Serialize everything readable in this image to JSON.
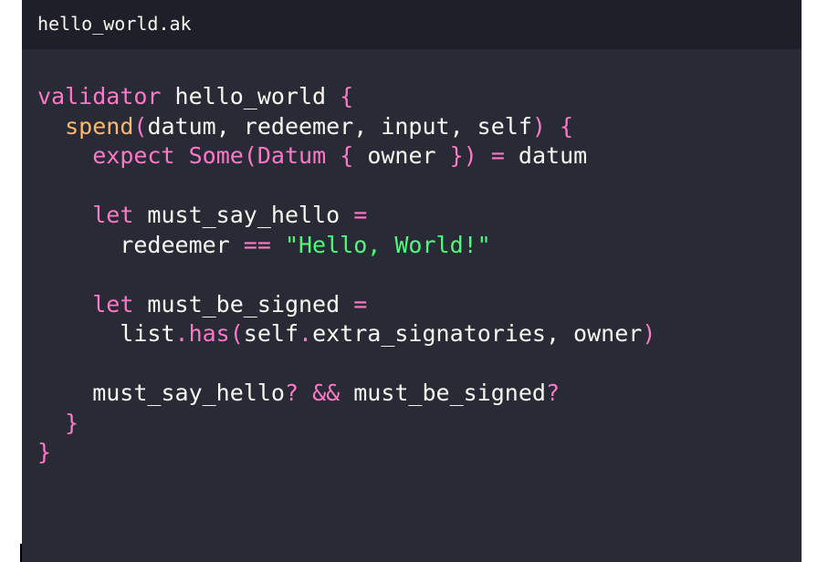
{
  "tab": {
    "filename": "hello_world.ak"
  },
  "theme": {
    "background": "#282a36",
    "tabbar_background": "#1e1f29",
    "text": "#f8f8f2",
    "keyword": "#ff79c6",
    "function": "#ffb86c",
    "string": "#50fa7b"
  },
  "code": {
    "lines": [
      [
        {
          "t": "validator",
          "c": "tok-keyword"
        },
        {
          "t": " hello_world ",
          "c": "tok-plain"
        },
        {
          "t": "{",
          "c": "tok-brace"
        }
      ],
      [
        {
          "t": "  ",
          "c": "tok-plain"
        },
        {
          "t": "spend",
          "c": "tok-func"
        },
        {
          "t": "(",
          "c": "tok-brace"
        },
        {
          "t": "datum, redeemer, input, self",
          "c": "tok-plain"
        },
        {
          "t": ")",
          "c": "tok-brace"
        },
        {
          "t": " ",
          "c": "tok-plain"
        },
        {
          "t": "{",
          "c": "tok-brace"
        }
      ],
      [
        {
          "t": "    ",
          "c": "tok-plain"
        },
        {
          "t": "expect",
          "c": "tok-keyword"
        },
        {
          "t": " ",
          "c": "tok-plain"
        },
        {
          "t": "Some",
          "c": "tok-type"
        },
        {
          "t": "(",
          "c": "tok-brace"
        },
        {
          "t": "Datum",
          "c": "tok-type"
        },
        {
          "t": " ",
          "c": "tok-plain"
        },
        {
          "t": "{",
          "c": "tok-brace"
        },
        {
          "t": " owner ",
          "c": "tok-plain"
        },
        {
          "t": "}",
          "c": "tok-brace"
        },
        {
          "t": ")",
          "c": "tok-brace"
        },
        {
          "t": " ",
          "c": "tok-plain"
        },
        {
          "t": "=",
          "c": "tok-op"
        },
        {
          "t": " datum",
          "c": "tok-plain"
        }
      ],
      [],
      [
        {
          "t": "    ",
          "c": "tok-plain"
        },
        {
          "t": "let",
          "c": "tok-keyword"
        },
        {
          "t": " must_say_hello ",
          "c": "tok-plain"
        },
        {
          "t": "=",
          "c": "tok-op"
        }
      ],
      [
        {
          "t": "      redeemer ",
          "c": "tok-plain"
        },
        {
          "t": "==",
          "c": "tok-op"
        },
        {
          "t": " ",
          "c": "tok-plain"
        },
        {
          "t": "\"Hello, World!\"",
          "c": "tok-string-content"
        }
      ],
      [],
      [
        {
          "t": "    ",
          "c": "tok-plain"
        },
        {
          "t": "let",
          "c": "tok-keyword"
        },
        {
          "t": " must_be_signed ",
          "c": "tok-plain"
        },
        {
          "t": "=",
          "c": "tok-op"
        }
      ],
      [
        {
          "t": "      list",
          "c": "tok-plain"
        },
        {
          "t": ".",
          "c": "tok-op"
        },
        {
          "t": "has",
          "c": "tok-keyword"
        },
        {
          "t": "(",
          "c": "tok-brace"
        },
        {
          "t": "self",
          "c": "tok-plain"
        },
        {
          "t": ".",
          "c": "tok-op"
        },
        {
          "t": "extra_signatories, owner",
          "c": "tok-plain"
        },
        {
          "t": ")",
          "c": "tok-brace"
        }
      ],
      [],
      [
        {
          "t": "    must_say_hello",
          "c": "tok-plain"
        },
        {
          "t": "?",
          "c": "tok-op"
        },
        {
          "t": " ",
          "c": "tok-plain"
        },
        {
          "t": "&&",
          "c": "tok-op"
        },
        {
          "t": " must_be_signed",
          "c": "tok-plain"
        },
        {
          "t": "?",
          "c": "tok-op"
        }
      ],
      [
        {
          "t": "  ",
          "c": "tok-plain"
        },
        {
          "t": "}",
          "c": "tok-brace"
        }
      ],
      [
        {
          "t": "}",
          "c": "tok-brace"
        }
      ]
    ]
  }
}
